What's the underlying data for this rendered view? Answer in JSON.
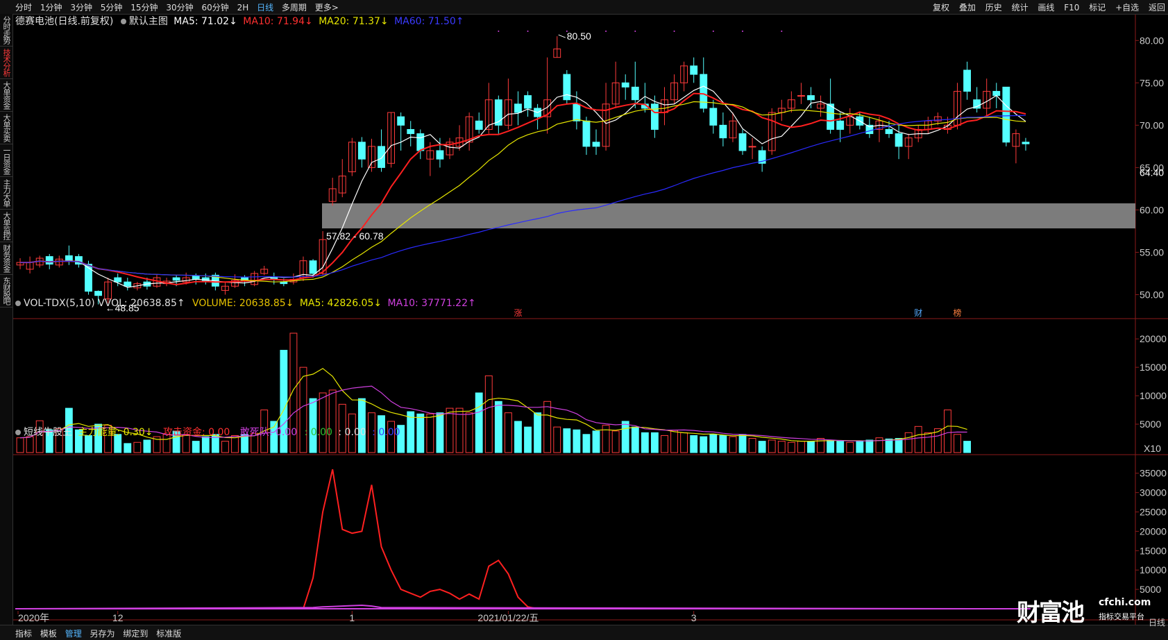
{
  "topbar": {
    "tabs": [
      "分时",
      "1分钟",
      "3分钟",
      "5分钟",
      "15分钟",
      "30分钟",
      "60分钟",
      "2H",
      "日线",
      "多周期",
      "更多>"
    ],
    "active_tab": 8,
    "tools": [
      "复权",
      "叠加",
      "历史",
      "统计",
      "画线",
      "F10",
      "标记",
      "+自选",
      "返回"
    ]
  },
  "sidebar": [
    "分时走势",
    "技术分析",
    "大单资金",
    "大单买卖",
    "一日资金",
    "主力大单",
    "大单监控",
    "财务资金",
    "东财股吧"
  ],
  "sidebar_active": 1,
  "bottombar": [
    "指标",
    "模板",
    "管理",
    "另存为",
    "绑定到",
    "标准版"
  ],
  "bottombar_active": 2,
  "bottom_right_label": "日线",
  "price_header": {
    "stock": "德赛电池(日线.前复权)",
    "main": "默认主图",
    "ma5": "MA5: 71.02↓",
    "ma10": "MA10: 71.94↓",
    "ma20": "MA20: 71.37↓",
    "ma60": "MA60: 71.50↑"
  },
  "vol_header": {
    "name": "VOL-TDX(5,10)",
    "vvol": "VVOL: 20638.85↑",
    "volume": "VOLUME: 20638.85↓",
    "ma5": "MA5: 42826.05↓",
    "ma10": "MA10: 37771.22↑"
  },
  "ind_header": {
    "name": "短线牛股王",
    "main": "主力能量: 0.30↓",
    "attack": "攻击资金: 0.00",
    "dare": "敢死队: 0.00",
    "extra1": ": 0.00",
    "extra2": ": 0.00",
    "extra3": ": 0.00"
  },
  "annotations": {
    "high": "80.50",
    "low": "48.85",
    "band": "57.82 - 60.78",
    "current_price": "64.40",
    "vol_multiplier": "X10",
    "marker_zhang": "涨",
    "marker_cai": "财",
    "marker_bang": "榜"
  },
  "x_labels": [
    "2020年",
    "12",
    "1",
    "2021/01/22/五",
    "3"
  ],
  "watermark": {
    "big": "财富池",
    "domain": "cfchi.com",
    "sub": "指标交易平台"
  },
  "colors": {
    "up": "#ff3b3b",
    "down": "#54ffff",
    "ma5": "#ffffff",
    "ma10": "#ff2020",
    "ma20": "#e6e600",
    "ma60": "#2a2aff",
    "band": "#8a8a8a"
  },
  "chart_data": [
    {
      "type": "candlestick",
      "title": "德赛电池(日线.前复权)",
      "yaxis_ticks": [
        50,
        55,
        60,
        65,
        70,
        75,
        80
      ],
      "ylim": [
        47.5,
        81.5
      ],
      "shaded_band": [
        57.82,
        60.78
      ],
      "x_tick_labels": [
        "2020年",
        "12",
        "1",
        "2021/01/22/五",
        "3"
      ],
      "candles": [
        [
          53.5,
          53.8,
          54.3,
          53.0
        ],
        [
          53.0,
          53.8,
          54.5,
          52.5
        ],
        [
          53.5,
          54.3,
          54.6,
          53.2
        ],
        [
          54.5,
          53.6,
          54.8,
          53.0
        ],
        [
          53.5,
          54.2,
          54.6,
          53.2
        ],
        [
          54.6,
          54.0,
          55.8,
          53.5
        ],
        [
          54.5,
          53.6,
          54.8,
          53.2
        ],
        [
          53.6,
          50.4,
          54.0,
          50.0
        ],
        [
          50.4,
          49.9,
          50.5,
          48.85
        ],
        [
          49.5,
          51.5,
          52.0,
          49.0
        ],
        [
          52.0,
          51.5,
          52.5,
          51.0
        ],
        [
          51.5,
          51.0,
          52.0,
          50.5
        ],
        [
          50.8,
          51.3,
          51.5,
          50.5
        ],
        [
          51.5,
          51.0,
          52.0,
          50.6
        ],
        [
          51.0,
          52.0,
          52.4,
          50.8
        ],
        [
          51.3,
          51.6,
          52.0,
          51.0
        ],
        [
          52.0,
          51.7,
          52.3,
          51.0
        ],
        [
          51.5,
          52.0,
          52.6,
          51.2
        ],
        [
          52.2,
          51.8,
          52.5,
          51.2
        ],
        [
          52.0,
          51.6,
          52.5,
          51.2
        ],
        [
          52.3,
          51.0,
          52.6,
          50.5
        ],
        [
          50.5,
          51.0,
          51.5,
          50.0
        ],
        [
          51.0,
          51.7,
          52.4,
          50.8
        ],
        [
          52.0,
          51.6,
          52.3,
          51.0
        ],
        [
          51.2,
          52.5,
          52.8,
          51.0
        ],
        [
          52.5,
          53.0,
          53.4,
          52.3
        ],
        [
          52.0,
          51.8,
          52.6,
          51.2
        ],
        [
          51.5,
          51.3,
          51.9,
          51.0
        ],
        [
          51.5,
          51.8,
          52.5,
          51.2
        ],
        [
          52.0,
          54.0,
          54.5,
          51.6
        ],
        [
          54.0,
          52.5,
          54.2,
          52.0
        ],
        [
          52.5,
          56.5,
          57.5,
          52.3
        ],
        [
          61.0,
          62.5,
          63.8,
          60.5
        ],
        [
          62.0,
          64.0,
          66.0,
          61.5
        ],
        [
          64.5,
          68.0,
          68.5,
          64.0
        ],
        [
          68.0,
          66.0,
          68.6,
          65.0
        ],
        [
          65.0,
          67.5,
          68.4,
          64.5
        ],
        [
          67.5,
          65.0,
          69.5,
          64.5
        ],
        [
          65.5,
          71.5,
          71.5,
          65.0
        ],
        [
          71.0,
          70.0,
          71.5,
          67.0
        ],
        [
          69.5,
          69.0,
          70.5,
          67.5
        ],
        [
          69.0,
          67.0,
          69.5,
          66.0
        ],
        [
          66.0,
          67.0,
          68.0,
          64.0
        ],
        [
          67.0,
          66.0,
          68.5,
          65.0
        ],
        [
          66.5,
          68.0,
          68.5,
          66.0
        ],
        [
          67.5,
          68.5,
          70.0,
          67.0
        ],
        [
          68.0,
          71.0,
          71.5,
          67.0
        ],
        [
          70.5,
          69.5,
          71.5,
          69.0
        ],
        [
          69.5,
          73.0,
          75.0,
          69.0
        ],
        [
          73.0,
          70.0,
          73.5,
          69.0
        ],
        [
          70.0,
          73.0,
          75.5,
          69.5
        ],
        [
          72.5,
          71.5,
          74.0,
          70.0
        ],
        [
          73.5,
          72.0,
          74.0,
          71.0
        ],
        [
          72.0,
          71.0,
          72.5,
          69.5
        ],
        [
          71.0,
          73.0,
          78.0,
          69.0
        ],
        [
          78.0,
          79.0,
          80.5,
          78.0
        ],
        [
          76.0,
          73.0,
          76.5,
          72.5
        ],
        [
          72.5,
          70.5,
          74.0,
          69.5
        ],
        [
          70.5,
          67.5,
          71.0,
          66.5
        ],
        [
          68.0,
          67.5,
          69.5,
          66.5
        ],
        [
          67.5,
          72.5,
          75.0,
          67.0
        ],
        [
          72.5,
          75.0,
          77.5,
          72.0
        ],
        [
          75.0,
          74.5,
          76.0,
          73.0
        ],
        [
          74.5,
          73.0,
          77.5,
          72.0
        ],
        [
          72.5,
          72.0,
          75.0,
          71.5
        ],
        [
          72.5,
          69.5,
          73.5,
          68.5
        ],
        [
          71.5,
          73.0,
          74.5,
          70.0
        ],
        [
          73.0,
          75.0,
          76.0,
          72.5
        ],
        [
          75.0,
          77.0,
          77.5,
          74.0
        ],
        [
          77.0,
          76.0,
          78.0,
          75.0
        ],
        [
          76.0,
          72.0,
          78.0,
          71.5
        ],
        [
          72.0,
          70.0,
          73.0,
          69.0
        ],
        [
          70.0,
          68.5,
          71.5,
          67.5
        ],
        [
          68.5,
          70.5,
          71.5,
          68.0
        ],
        [
          69.0,
          67.0,
          69.5,
          66.5
        ],
        [
          67.5,
          67.5,
          68.5,
          66.0
        ],
        [
          67.0,
          65.5,
          67.5,
          64.5
        ],
        [
          67.0,
          71.5,
          72.0,
          66.5
        ],
        [
          71.5,
          72.0,
          73.0,
          70.5
        ],
        [
          72.0,
          73.0,
          74.0,
          71.5
        ],
        [
          73.5,
          73.5,
          75.0,
          72.5
        ],
        [
          73.5,
          73.0,
          74.5,
          72.0
        ],
        [
          72.0,
          72.5,
          73.5,
          71.0
        ],
        [
          72.5,
          69.5,
          75.5,
          69.0
        ],
        [
          70.5,
          69.5,
          71.5,
          68.0
        ],
        [
          70.0,
          71.0,
          72.0,
          69.0
        ],
        [
          71.0,
          70.0,
          71.5,
          69.5
        ],
        [
          70.0,
          69.0,
          71.0,
          68.5
        ],
        [
          69.5,
          70.5,
          71.0,
          68.0
        ],
        [
          69.5,
          69.0,
          70.5,
          68.5
        ],
        [
          69.0,
          67.5,
          70.0,
          66.0
        ],
        [
          67.5,
          68.5,
          69.0,
          66.0
        ],
        [
          68.5,
          69.5,
          70.0,
          68.0
        ],
        [
          69.5,
          70.5,
          71.0,
          69.0
        ],
        [
          70.5,
          71.0,
          71.5,
          70.0
        ],
        [
          69.5,
          70.0,
          71.0,
          69.0
        ],
        [
          70.0,
          74.0,
          75.0,
          69.5
        ],
        [
          76.5,
          74.0,
          77.5,
          73.0
        ],
        [
          73.0,
          72.0,
          74.5,
          71.5
        ],
        [
          72.0,
          74.0,
          75.5,
          71.0
        ],
        [
          74.0,
          73.5,
          75.0,
          72.0
        ],
        [
          74.5,
          68.0,
          74.5,
          67.5
        ],
        [
          67.5,
          69.0,
          69.5,
          65.5
        ],
        [
          68.0,
          67.8,
          68.5,
          67.0
        ]
      ],
      "ma_series": [
        "MA5",
        "MA10",
        "MA20",
        "MA60"
      ]
    },
    {
      "type": "bar",
      "title": "VOL-TDX(5,10)",
      "yaxis_ticks": [
        5000,
        10000,
        15000,
        20000
      ],
      "ylim": [
        0,
        21000
      ],
      "values": [
        2600,
        2800,
        5600,
        4000,
        4200,
        7800,
        4000,
        3000,
        5000,
        4800,
        3200,
        1600,
        1800,
        2200,
        2800,
        3200,
        3800,
        3200,
        2000,
        2800,
        3200,
        2000,
        3000,
        3200,
        3400,
        7500,
        5500,
        18000,
        21000,
        15000,
        9500,
        10500,
        11000,
        8500,
        6800,
        9500,
        7000,
        6500,
        5500,
        4800,
        7200,
        6800,
        6800,
        7000,
        7800,
        7800,
        7000,
        10500,
        13500,
        9000,
        7000,
        5500,
        4500,
        7000,
        9000,
        4500,
        4200,
        4000,
        3200,
        3800,
        4800,
        3800,
        5500,
        4500,
        3500,
        3500,
        3000,
        3900,
        3500,
        3000,
        2800,
        3200,
        3000,
        2800,
        3200,
        2500,
        2000,
        2200,
        2000,
        1800,
        2000,
        2000,
        2500,
        2200,
        2000,
        1800,
        2000,
        2200,
        2600,
        2400,
        2500,
        3500,
        4600,
        3500,
        4200,
        7500,
        3200,
        2000
      ],
      "series": [
        "MA5",
        "MA10"
      ]
    },
    {
      "type": "line",
      "title": "短线牛股王",
      "yaxis_ticks": [
        5000,
        10000,
        15000,
        20000,
        25000,
        30000,
        35000
      ],
      "ylim": [
        0,
        38000
      ],
      "series": [
        {
          "name": "攻击资金",
          "x": [
            0,
            24,
            25,
            26,
            27,
            28,
            29,
            30,
            31,
            32,
            33,
            34,
            35,
            36,
            37,
            38,
            39,
            40,
            41,
            42,
            43,
            44,
            45,
            46,
            47,
            48,
            49,
            50,
            51,
            52,
            53,
            98
          ],
          "values": [
            0,
            0,
            0,
            0,
            0,
            0,
            0,
            8000,
            25000,
            36000,
            20500,
            19500,
            20000,
            32000,
            16000,
            10000,
            5000,
            4000,
            3000,
            4500,
            5000,
            4000,
            2500,
            3800,
            2500,
            11000,
            12500,
            9000,
            3000,
            500,
            0,
            0
          ]
        },
        {
          "name": "敢死队",
          "x": [
            0,
            30,
            31,
            32,
            33,
            34,
            35,
            36,
            37,
            98
          ],
          "values": [
            0,
            300,
            500,
            600,
            700,
            800,
            900,
            700,
            300,
            0
          ]
        }
      ]
    }
  ]
}
